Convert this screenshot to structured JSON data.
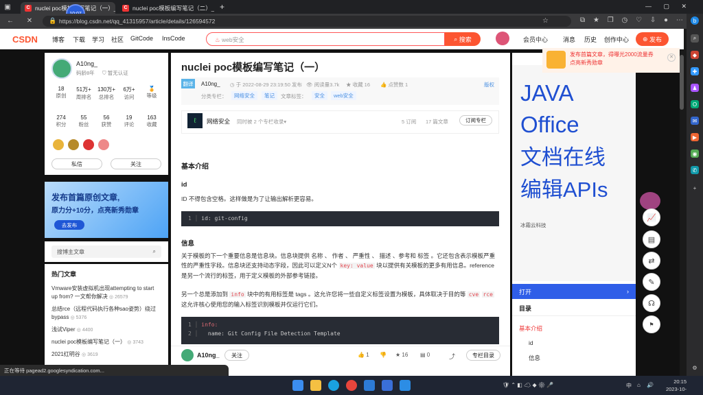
{
  "browser": {
    "time_bubble": "10:07",
    "tabs": [
      {
        "title": "nuclei poc模板编写笔记（一）_ n"
      },
      {
        "title": "nuclei poc模板编写笔记（二）_ n"
      }
    ],
    "new_tab": "+",
    "url": "https://blog.csdn.net/qq_41315957/article/details/126594572",
    "window_controls": [
      "—",
      "▢",
      "✕"
    ]
  },
  "header": {
    "logo": "CSDN",
    "nav": [
      "博客",
      "下载",
      "学习",
      "社区",
      "GitCode",
      "InsCode"
    ],
    "search_placeholder": "web安全",
    "search_button": "搜索",
    "right_links": [
      "会员中心",
      "消息",
      "历史",
      "创作中心"
    ],
    "publish_button": "发布"
  },
  "profile": {
    "name": "A10ng_",
    "years": "码龄8年",
    "cert": "暂无认证",
    "stats_row1": [
      {
        "value": "18",
        "label": "原创"
      },
      {
        "value": "51万+",
        "label": "周排名"
      },
      {
        "value": "130万+",
        "label": "总排名"
      },
      {
        "value": "6万+",
        "label": "访问"
      },
      {
        "value": "",
        "label": "等级"
      }
    ],
    "stats_row2": [
      {
        "value": "274",
        "label": "积分"
      },
      {
        "value": "55",
        "label": "粉丝"
      },
      {
        "value": "56",
        "label": "获赞"
      },
      {
        "value": "19",
        "label": "评论"
      },
      {
        "value": "163",
        "label": "收藏"
      }
    ],
    "message_button": "私信",
    "follow_button": "关注"
  },
  "banner": {
    "line1": "发布首篇原创文章,",
    "line2": "原力分+10分，点亮新秀勋章",
    "cta": "去发布"
  },
  "blog_search": {
    "placeholder": "搜博主文章"
  },
  "hot": {
    "title": "热门文章",
    "items": [
      {
        "title": "Vmware安装虚拟机出现attempting to start up from? 一文帮你解决",
        "count": "26579"
      },
      {
        "title": "总结rce（远程代码执行各种sao姿势）绕过bypass",
        "count": "5376"
      },
      {
        "title": "浅试Viper",
        "count": "4400"
      },
      {
        "title": "nuclei poc模板编写笔记（一）",
        "count": "3743"
      },
      {
        "title": "2021红明谷",
        "count": "3619"
      }
    ]
  },
  "article": {
    "title": "nuclei poc模板编写笔记（一）",
    "tag": "翻译",
    "author": "A10ng_",
    "date": "于 2022-08-29 23:19:50 发布",
    "reads": "阅读量3.7k",
    "favorites": "收藏 16",
    "likes": "点赞数 1",
    "copyright": "版权",
    "category_label": "分类专栏：",
    "categories": [
      "网络安全",
      "笔记"
    ],
    "tags_label": "文章标签：",
    "tags": [
      "安全",
      "web安全"
    ],
    "column": {
      "name": "网络安全",
      "desc": "同时被 2 个专栏收录",
      "subs": "5 订阅",
      "count": "17 篇文章",
      "button": "订阅专栏"
    },
    "h_basic": "基本介绍",
    "h_id": "id",
    "p_id": "ID 不得包含空格。这样做是为了让输出解析更容易。",
    "code1": {
      "line": "1",
      "text": "id: git-config"
    },
    "h_info": "信息",
    "p_info1": "关于模板的下一个重要信息是信息块。信息块提供 名称 、 作者 、 严重性 、 描述 、参考和 标签 。它还包含表示模板严重性的严重性字段。信息块还支持动态字段，因此可以定义N个",
    "p_info1_code": "key: value",
    "p_info1_end": "块以提供有关模板的更多有用信息。reference是另一个流行的标签，用于定义模板的外部参考链接。",
    "p_info2a": "另一个总是添加到",
    "p_info2_code1": "info",
    "p_info2b": "块中的有用标签是 tags 。这允许您将一些自定义标签设置为模板，具体取决于目的等",
    "p_info2_code2": "cve",
    "p_info2_code3": "rce",
    "p_info2c": "这允许核心使用您的输入标签识别模板并仅运行它们。",
    "code2": [
      {
        "line": "1",
        "text": "info:"
      },
      {
        "line": "2",
        "text": "  name: Git Config File Detection Template"
      },
      {
        "line": "3",
        "text": ""
      }
    ]
  },
  "toolbar": {
    "author": "A10ng_",
    "follow": "关注",
    "likes": "1",
    "favorites": "16",
    "comments": "0",
    "toc": "专栏目录"
  },
  "right": {
    "promo_line1": "发布首篇文章，得曝光2000流量券",
    "promo_line2": "点亮新秀勋章",
    "ad_lines": [
      "JAVA",
      "Office",
      "文档在线",
      "编辑APIs"
    ],
    "ad_brand": "冰霜云科技",
    "open": "打开",
    "toc_title": "目录",
    "toc_items": [
      "基本介绍",
      "id",
      "信息"
    ]
  },
  "status_bar": "正在等待 pagead2.googlesyndication.com...",
  "taskbar": {
    "clock_time": "20:15",
    "clock_date": "2023-10-14",
    "lang": "中"
  },
  "colors": {
    "brand": "#fc5531",
    "accent_blue": "#2f5ee8"
  }
}
